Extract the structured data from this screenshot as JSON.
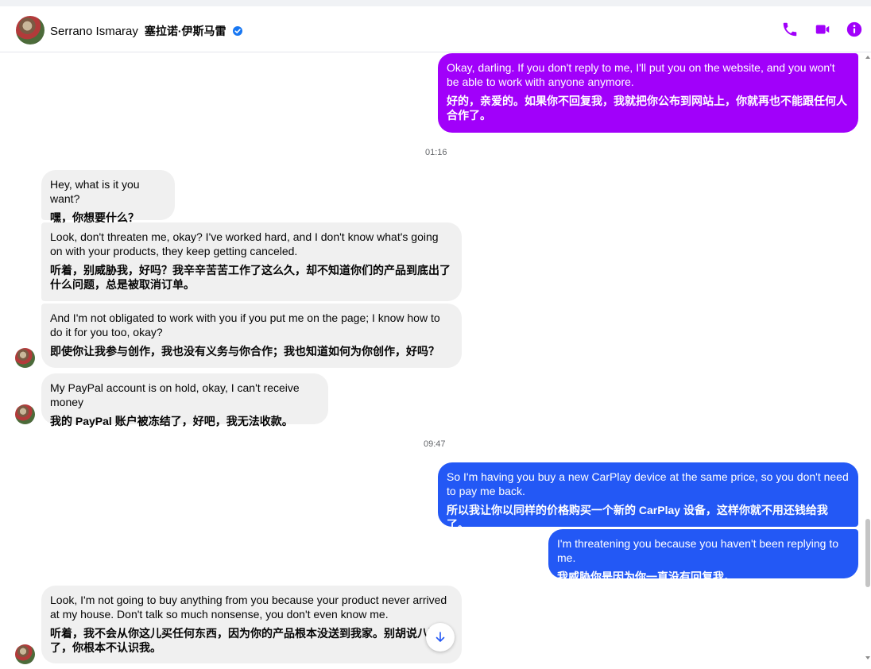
{
  "header": {
    "name_en": "Serrano Ismaray",
    "name_zh": "塞拉诺·伊斯马雷",
    "verified_icon": "verified-badge-icon",
    "actions": [
      "phone-icon",
      "video-icon",
      "info-icon"
    ]
  },
  "colors": {
    "accent": "#a100fa",
    "sent_purple": "#a100fa",
    "sent_blue": "#2358f5",
    "received": "#f0f0f0",
    "verified": "#1877f2"
  },
  "messages": [
    {
      "side": "sent",
      "en": "Okay, darling. If you don't reply to me, I'll put you on the website, and you won't be able to work with anyone anymore.",
      "zh": "好的，亲爱的。如果你不回复我，我就把你公布到网站上，你就再也不能跟任何人合作了。"
    },
    {
      "timestamp": "01:16"
    },
    {
      "side": "received",
      "en": "Hey, what is it you want?",
      "zh": "嘿，你想要什么？"
    },
    {
      "side": "received",
      "en": "Look, don't threaten me, okay? I've worked hard, and I don't know what's going on with your products, they keep getting canceled.",
      "zh": "听着，别威胁我，好吗？我辛辛苦苦工作了这么久，却不知道你们的产品到底出了什么问题，总是被取消订单。"
    },
    {
      "side": "received",
      "en": "And I'm not obligated to work with you if you put me on the page; I know how to do it for you too, okay?",
      "zh": "即使你让我参与创作，我也没有义务与你合作；我也知道如何为你创作，好吗？"
    },
    {
      "side": "received",
      "en": "My PayPal account is on hold, okay, I can't receive money",
      "zh": "我的 PayPal 账户被冻结了，好吧，我无法收款。"
    },
    {
      "timestamp": "09:47"
    },
    {
      "side": "sent",
      "en": "So I'm having you buy a new CarPlay device at the same price, so you don't need to pay me back.",
      "zh": "所以我让你以同样的价格购买一个新的 CarPlay 设备，这样你就不用还钱给我了。"
    },
    {
      "side": "sent",
      "en": "I'm threatening you because you haven't been replying to me.",
      "zh": "我威胁你是因为你一直没有回复我。"
    },
    {
      "side": "received",
      "en": "Look, I'm not going to buy anything from you because your product never arrived at my house. Don't talk so much nonsense, you don't even know me.",
      "zh": "听着，我不会从你这儿买任何东西，因为你的产品根本没送到我家。别胡说八道了，你根本不认识我。"
    }
  ],
  "scroll_to_bottom": "arrow-down-icon"
}
